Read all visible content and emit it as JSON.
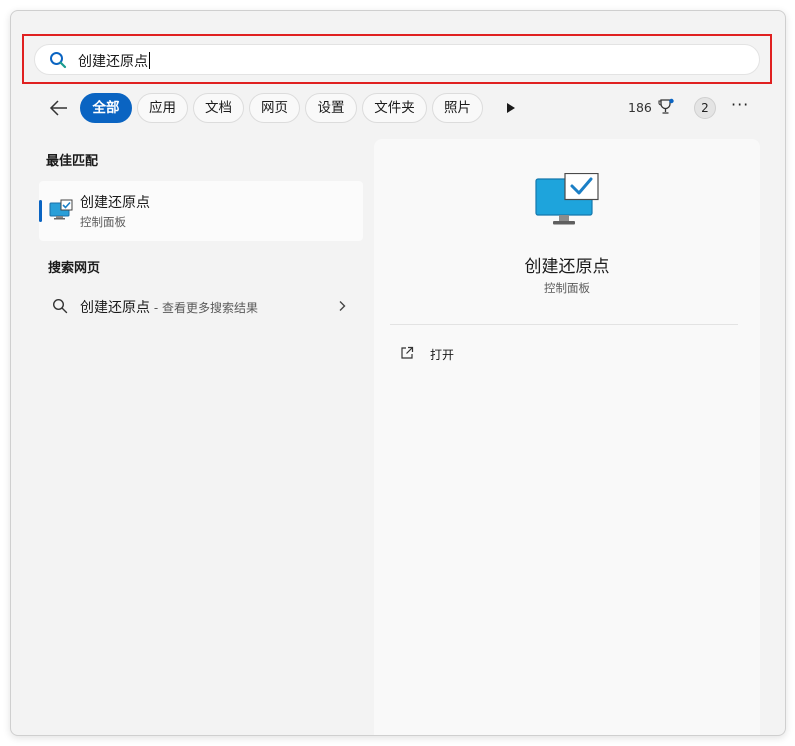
{
  "search": {
    "query": "创建还原点"
  },
  "tabs": [
    {
      "label": "全部",
      "active": true
    },
    {
      "label": "应用"
    },
    {
      "label": "文档"
    },
    {
      "label": "网页"
    },
    {
      "label": "设置"
    },
    {
      "label": "文件夹"
    },
    {
      "label": "照片"
    }
  ],
  "toolbar": {
    "points": "186",
    "avatar_count": "2",
    "more_label": "···"
  },
  "best_match": {
    "title": "最佳匹配",
    "item": {
      "name": "创建还原点",
      "subtitle": "控制面板"
    }
  },
  "web_search": {
    "title": "搜索网页",
    "item": {
      "query": "创建还原点",
      "suffix": " - 查看更多搜索结果"
    }
  },
  "detail": {
    "name": "创建还原点",
    "subtitle": "控制面板",
    "actions": [
      {
        "label": "打开"
      }
    ]
  },
  "colors": {
    "accent": "#0a64c2",
    "highlight_border": "#e02020",
    "window_bg": "#f3f3f3"
  },
  "icons": [
    "search-icon",
    "back-arrow-icon",
    "play-icon",
    "trophy-icon",
    "monitor-check-icon",
    "chevron-right-icon",
    "open-external-icon"
  ]
}
